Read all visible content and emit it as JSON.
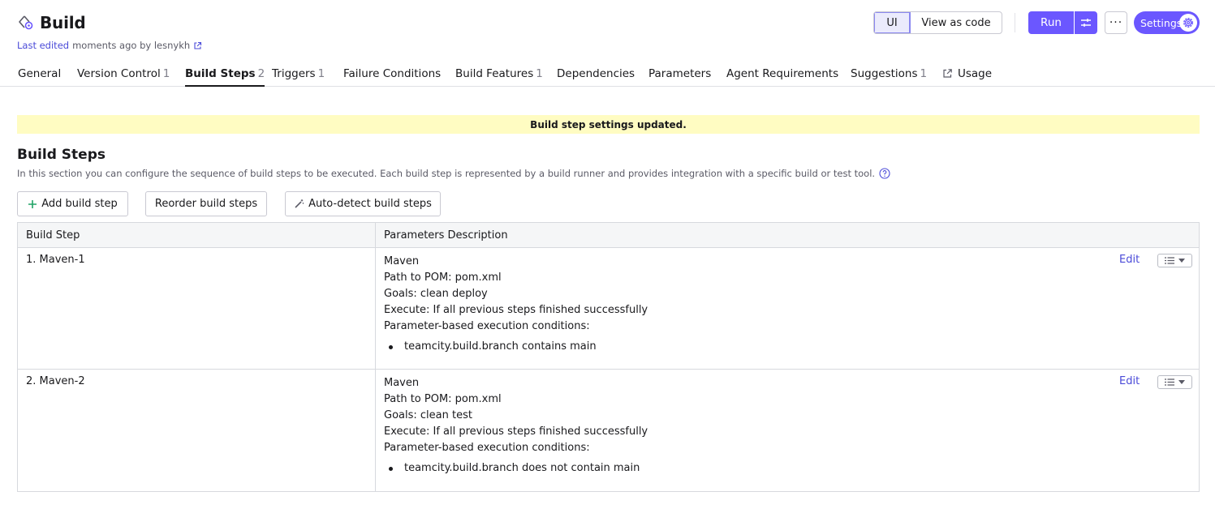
{
  "header": {
    "title": "Build",
    "last_edited_link": "Last edited",
    "last_edited_rest": "moments ago by lesnykh",
    "ui_label": "UI",
    "view_as_code_label": "View as code",
    "run_label": "Run",
    "more_label": "···",
    "settings_label": "Settings"
  },
  "tabs": [
    {
      "label": "General",
      "count": ""
    },
    {
      "label": "Version Control",
      "count": "1"
    },
    {
      "label": "Build Steps",
      "count": "2"
    },
    {
      "label": "Triggers",
      "count": "1"
    },
    {
      "label": "Failure Conditions",
      "count": ""
    },
    {
      "label": "Build Features",
      "count": "1"
    },
    {
      "label": "Dependencies",
      "count": ""
    },
    {
      "label": "Parameters",
      "count": ""
    },
    {
      "label": "Agent Requirements",
      "count": ""
    },
    {
      "label": "Suggestions",
      "count": "1"
    },
    {
      "label": "Usage",
      "count": ""
    }
  ],
  "banner": "Build step settings updated.",
  "section": {
    "title": "Build Steps",
    "description": "In this section you can configure the sequence of build steps to be executed. Each build step is represented by a build runner and provides integration with a specific build or test tool."
  },
  "actions": {
    "add_label": "Add build step",
    "reorder_label": "Reorder build steps",
    "autodetect_label": "Auto-detect build steps"
  },
  "table": {
    "headers": [
      "Build Step",
      "Parameters Description"
    ],
    "edit_label": "Edit",
    "rows": [
      {
        "name": "1. Maven-1",
        "runner": "Maven",
        "pom": "Path to POM: pom.xml",
        "goals": "Goals: clean deploy",
        "execute": "Execute: If all previous steps finished successfully",
        "conditions_label": "Parameter-based execution conditions:",
        "condition": "teamcity.build.branch contains main"
      },
      {
        "name": "2. Maven-2",
        "runner": "Maven",
        "pom": "Path to POM: pom.xml",
        "goals": "Goals: clean test",
        "execute": "Execute: If all previous steps finished successfully",
        "conditions_label": "Parameter-based execution conditions:",
        "condition": "teamcity.build.branch does not contain main"
      }
    ]
  },
  "colors": {
    "accent": "#6b57ff",
    "link": "#4a4ad8",
    "banner": "#fffcc2",
    "add_icon": "#21a366"
  },
  "icons": [
    "build-config-icon",
    "external-link-icon",
    "run-options-icon",
    "gear-icon",
    "help-icon",
    "plus-icon",
    "magic-wand-icon",
    "list-icon",
    "chevron-down-icon"
  ]
}
